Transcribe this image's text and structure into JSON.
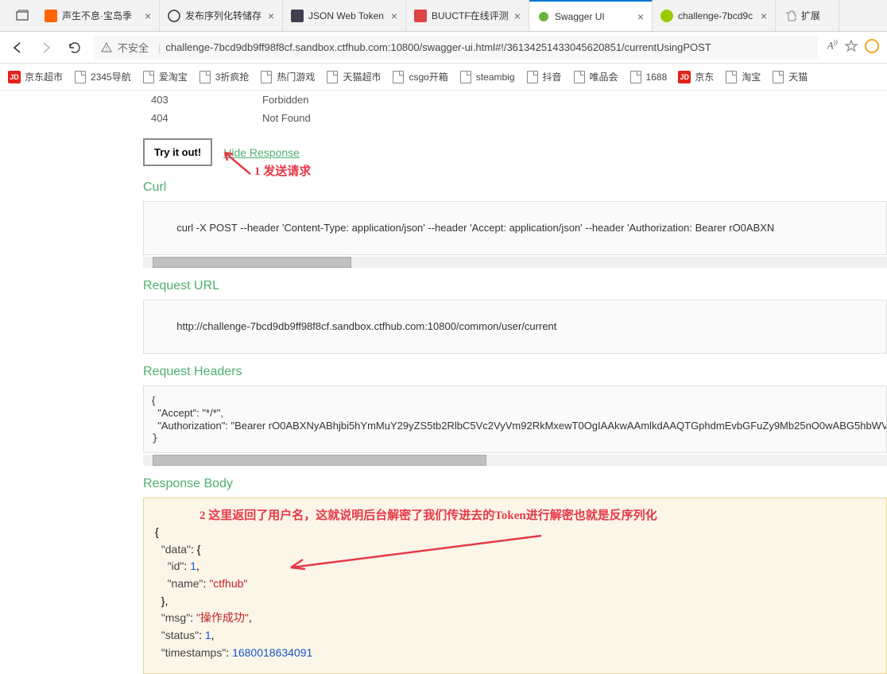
{
  "tabs": [
    {
      "title": "声生不息·宝岛季",
      "favicon_color": "#ff6600"
    },
    {
      "title": "发布序列化转储存",
      "favicon_color": "#333"
    },
    {
      "title": "JSON Web Token",
      "favicon_color": "#555"
    },
    {
      "title": "BUUCTF在线评测",
      "favicon_color": "#d44"
    },
    {
      "title": "Swagger UI",
      "favicon_color": "#6db33f",
      "active": true
    },
    {
      "title": "challenge-7bcd9c",
      "favicon_color": "#9c0"
    },
    {
      "title": "扩展",
      "favicon_color": "#999",
      "narrow": true
    }
  ],
  "addressbar": {
    "security": "不安全",
    "url": "challenge-7bcd9db9ff98f8cf.sandbox.ctfhub.com:10800/swagger-ui.html#!/36134251433045620851/currentUsingPOST"
  },
  "bookmarks": [
    {
      "label": "京东超市",
      "type": "jd"
    },
    {
      "label": "2345导航"
    },
    {
      "label": "爱淘宝"
    },
    {
      "label": "3折疯抢"
    },
    {
      "label": "热门游戏"
    },
    {
      "label": "天猫超市"
    },
    {
      "label": "csgo开箱"
    },
    {
      "label": "steambig"
    },
    {
      "label": "抖音"
    },
    {
      "label": "唯品会"
    },
    {
      "label": "1688"
    },
    {
      "label": "京东",
      "type": "jd"
    },
    {
      "label": "淘宝"
    },
    {
      "label": "天猫"
    }
  ],
  "response_codes": [
    {
      "code": "403",
      "desc": "Forbidden"
    },
    {
      "code": "404",
      "desc": "Not Found"
    }
  ],
  "buttons": {
    "try_it": "Try it out!",
    "hide_response": "Hide Response"
  },
  "annotations": {
    "a1": "1 发送请求",
    "a2": "2 这里返回了用户名，这就说明后台解密了我们传进去的Token进行解密也就是反序列化"
  },
  "sections": {
    "curl": "Curl",
    "request_url": "Request URL",
    "request_headers": "Request Headers",
    "response_body": "Response Body"
  },
  "curl_cmd": "curl -X POST --header 'Content-Type: application/json' --header 'Accept: application/json' --header 'Authorization: Bearer rO0ABXN",
  "request_url": "http://challenge-7bcd9db9ff98f8cf.sandbox.ctfhub.com:10800/common/user/current",
  "request_headers": "{\n  \"Accept\": \"*/*\",\n  \"Authorization\": \"Bearer rO0ABXNyABhjbi5hYmMuY29yZS5tb2RlbC5Vc2VyVm92RkMxewT0OgIAAkwAAmlkdAAQTGphdmEvbGFuZy9Mb25nO0wABG5hbWV0AB3",
  "response_body": {
    "data_label": "\"data\"",
    "id_key": "\"id\"",
    "id_val": "1",
    "name_key": "\"name\"",
    "name_val": "\"ctfhub\"",
    "msg_key": "\"msg\"",
    "msg_val": "\"操作成功\"",
    "status_key": "\"status\"",
    "status_val": "1",
    "ts_key": "\"timestamps\"",
    "ts_val": "1680018634091"
  }
}
